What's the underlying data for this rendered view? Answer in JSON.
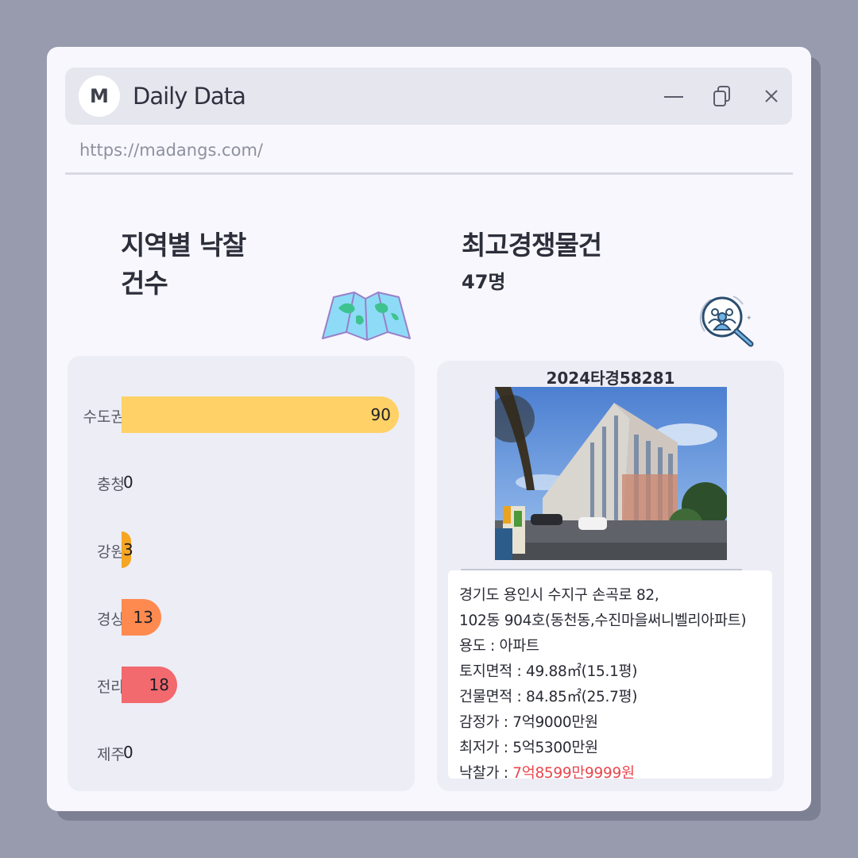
{
  "window": {
    "logo_letter": "M",
    "title": "Daily Data",
    "url": "https://madangs.com/"
  },
  "left_section": {
    "title_line1": "지역별 낙찰",
    "title_line2": "건수",
    "icon": "map-icon"
  },
  "right_section": {
    "title": "최고경쟁물건",
    "subtitle": "47명",
    "icon": "people-search-icon"
  },
  "chart_data": {
    "type": "bar",
    "orientation": "horizontal",
    "categories": [
      "수도권",
      "충청",
      "강원",
      "경상",
      "전라",
      "제주"
    ],
    "values": [
      90,
      0,
      3,
      13,
      18,
      0
    ],
    "colors": [
      "#ffd166",
      "#ffd166",
      "#f5a623",
      "#ff8a50",
      "#f2696e",
      "#f2696e"
    ],
    "xlim": [
      0,
      90
    ]
  },
  "property": {
    "case_number": "2024타경58281",
    "address_line1": "경기도 용인시 수지구 손곡로 82,",
    "address_line2": "102동 904호(동천동,수진마을써니벨리아파트)",
    "usage_label": "용도 : ",
    "usage": "아파트",
    "land_label": "토지면적 : ",
    "land_area": "49.88㎡(15.1평)",
    "building_label": "건물면적 : ",
    "building_area": "84.85㎡(25.7평)",
    "appraisal_label": "감정가 : ",
    "appraisal": "7억9000만원",
    "minimum_label": "최저가 : ",
    "minimum": "5억5300만원",
    "winning_label": "낙찰가 : ",
    "winning": "7억8599만9999원"
  }
}
